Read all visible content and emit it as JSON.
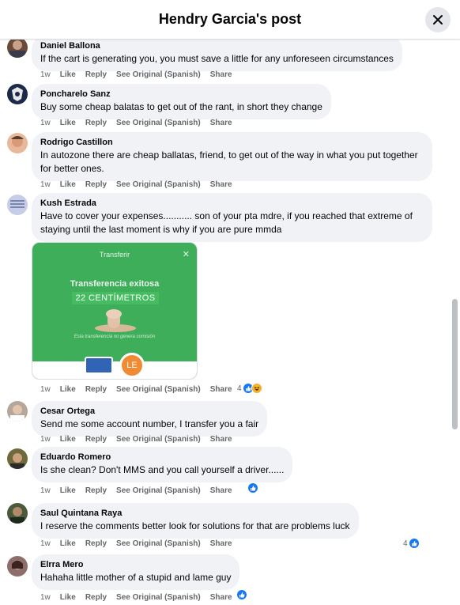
{
  "header": {
    "title": "Hendry Garcia's post"
  },
  "actions": {
    "time": "1w",
    "like": "Like",
    "reply": "Reply",
    "see_original": "See Original (Spanish)",
    "share": "Share"
  },
  "comments": [
    {
      "author": "Daniel Ballona",
      "text": "If the cart is generating you, you must save a little for any unforeseen circumstances"
    },
    {
      "author": "Poncharelo Sanz",
      "text": "Buy some cheap balatas to get out of the rant, in short they change"
    },
    {
      "author": "Rodrigo Castillon",
      "text": "In autozone there are cheap ballatas, friend, to get out of the way in what you put together for better ones."
    },
    {
      "author": "Kush Estrada",
      "text": "Have to cover your expenses........... son of your pta mdre, if you reached that extreme of staying until the last moment is why if you are pure mmda",
      "reaction_count": "4"
    },
    {
      "author": "Cesar Ortega",
      "text": "Send me some account number, I transfer you a fair"
    },
    {
      "author": "Eduardo Romero",
      "text": "Is she clean? Don't MMS and you call yourself a driver......"
    },
    {
      "author": "Saul Quintana Raya",
      "text": "I reserve the comments better look for solutions for that are problems luck",
      "reaction_count": "4"
    },
    {
      "author": "Elrra Mero",
      "text": "Hahaha little mother of a stupid and lame guy"
    }
  ],
  "attachment": {
    "title": "Transferir",
    "heading": "Transferencia exitosa",
    "subheading": "22 CENTÍMETROS",
    "note": "Esta transferencia no genera comisión",
    "badge": "LE"
  },
  "colors": {
    "accent": "#1877f2",
    "bubble": "#f0f2f5",
    "muted": "#65676b",
    "green": "#3fae5a"
  }
}
